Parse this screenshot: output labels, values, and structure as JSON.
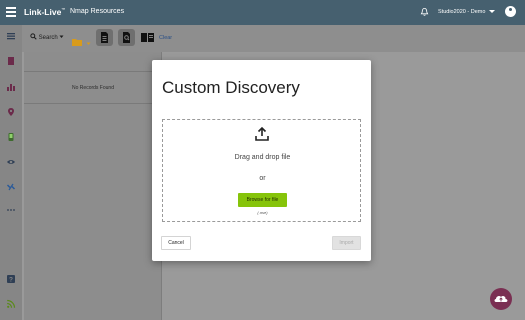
{
  "topbar": {
    "brand": "Link-Live",
    "brand_tm": "™",
    "page_name": "Nmap Resources",
    "user_label": "Studio2020 - Demo",
    "bg_color": "#46606f"
  },
  "sidebar": {
    "items": [
      {
        "icon": "list-icon"
      },
      {
        "icon": "document-icon"
      },
      {
        "icon": "bar-chart-icon"
      },
      {
        "icon": "location-pin-icon"
      },
      {
        "icon": "device-icon"
      },
      {
        "icon": "eye-icon"
      },
      {
        "icon": "link-icon"
      },
      {
        "icon": "more-icon"
      },
      {
        "icon": "help-icon"
      },
      {
        "icon": "rss-icon"
      }
    ]
  },
  "toolbar": {
    "search_label": "Search",
    "clear_label": "Clear"
  },
  "left_panel": {
    "empty_text": "No Records Found"
  },
  "modal": {
    "title": "Custom Discovery",
    "drop_text": "Drag and drop file",
    "or_text": "or",
    "browse_label": "Browse for file",
    "hint": "(.nse)",
    "cancel_label": "Cancel",
    "import_label": "Import",
    "browse_color": "#86c40a"
  },
  "fab": {
    "icon": "cloud-upload-icon",
    "color": "#7a2f52"
  }
}
